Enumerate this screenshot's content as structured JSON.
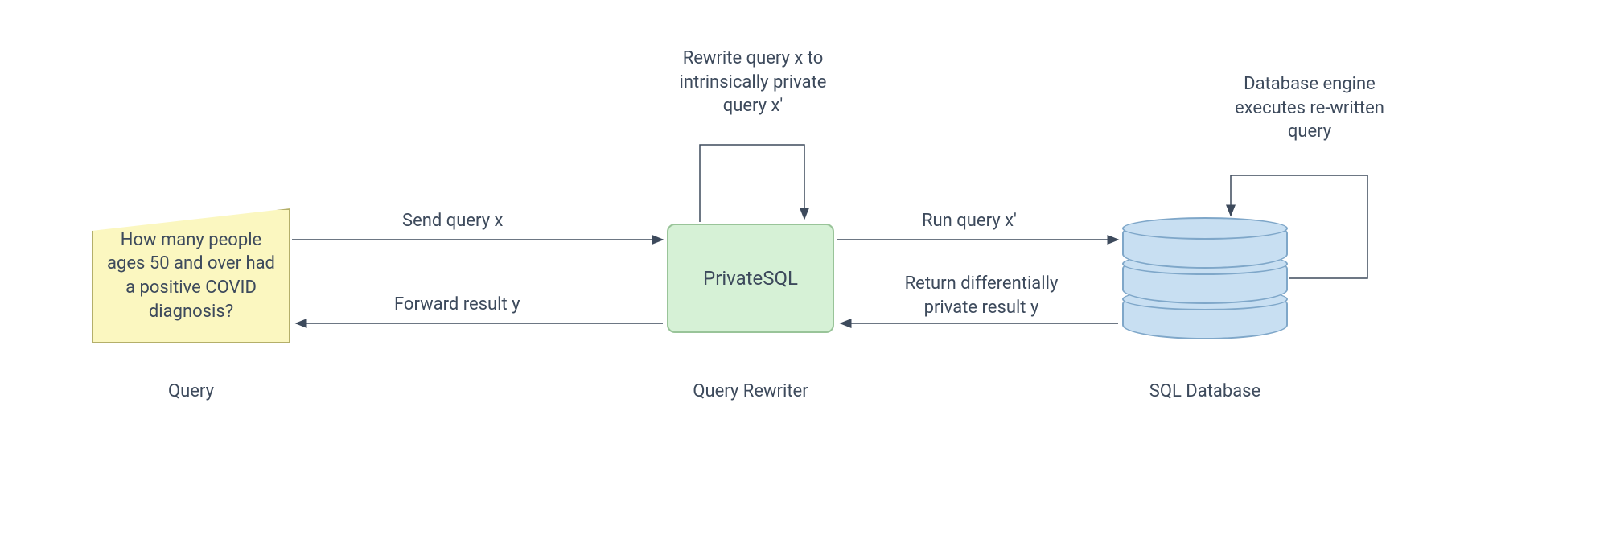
{
  "nodes": {
    "query": {
      "text": "How many people ages 50 and over had a positive COVID diagnosis?",
      "label": "Query"
    },
    "rewriter": {
      "text": "PrivateSQL",
      "label": "Query Rewriter"
    },
    "database": {
      "label": "SQL Database"
    }
  },
  "edges": {
    "send_query": "Send query x",
    "forward_result": "Forward result y",
    "run_query": "Run query x'",
    "return_result_line1": "Return differentially",
    "return_result_line2": "private result y",
    "rewrite_loop_line1": "Rewrite query x to",
    "rewrite_loop_line2": "intrinsically private",
    "rewrite_loop_line3": "query x'",
    "db_loop_line1": "Database engine",
    "db_loop_line2": "executes re-written",
    "db_loop_line3": "query"
  }
}
